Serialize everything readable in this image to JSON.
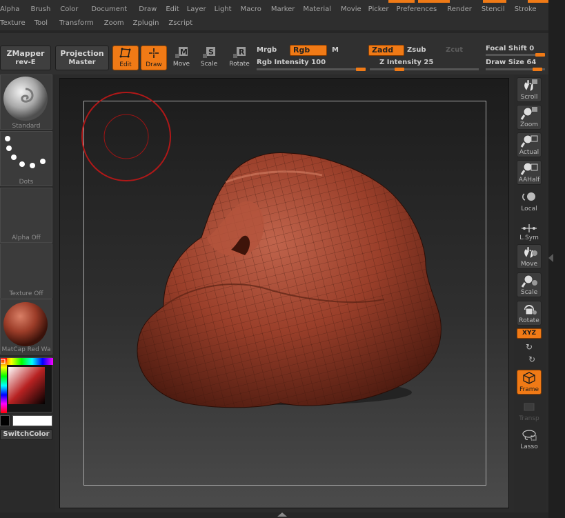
{
  "menu": {
    "row1": [
      "Alpha",
      "Brush",
      "Color",
      "Document",
      "Draw",
      "Edit",
      "Layer",
      "Light",
      "Macro",
      "Marker",
      "Material",
      "Movie",
      "Picker",
      "Preferences",
      "Render",
      "Stencil",
      "Stroke"
    ],
    "row2": [
      "Texture",
      "Tool",
      "Transform",
      "Zoom",
      "Zplugin",
      "Zscript"
    ]
  },
  "shelf": {
    "zmapper_line1": "ZMapper",
    "zmapper_line2": "rev-E",
    "projection_line1": "Projection",
    "projection_line2": "Master",
    "edit_label": "Edit",
    "draw_label": "Draw",
    "move_label": "Move",
    "scale_label": "Scale",
    "rotate_label": "Rotate",
    "mrgb_label": "Mrgb",
    "rgb_label": "Rgb",
    "m_label": "M",
    "zadd_label": "Zadd",
    "zsub_label": "Zsub",
    "zcut_label": "Zcut",
    "rgb_intensity_label": "Rgb Intensity 100",
    "z_intensity_label": "Z Intensity 25",
    "focal_shift_label": "Focal Shift 0",
    "draw_size_label": "Draw Size 64"
  },
  "left_palette": {
    "standard_label": "Standard",
    "dots_label": "Dots",
    "alpha_label": "Alpha Off",
    "texture_label": "Texture Off",
    "matcap_label": "MatCap Red Wa",
    "switch_color_label": "SwitchColor"
  },
  "right_palette": {
    "scroll": "Scroll",
    "zoom": "Zoom",
    "actual": "Actual",
    "aahalf": "AAHalf",
    "local": "Local",
    "lsym": "L.Sym",
    "move": "Move",
    "scale": "Scale",
    "rotate": "Rotate",
    "xyz": "XYZ",
    "frame": "Frame",
    "transp": "Transp",
    "lasso": "Lasso"
  },
  "colors": {
    "accent": "#f07a16",
    "model": "#9a3f2a",
    "brush_ring": "#b01818"
  },
  "icons": [
    "scroll-icon",
    "zoom-icon",
    "actual-icon",
    "aahalf-icon",
    "local-icon",
    "lsym-icon",
    "move-icon",
    "scale-icon",
    "rotate-icon",
    "frame-icon",
    "lasso-icon"
  ]
}
